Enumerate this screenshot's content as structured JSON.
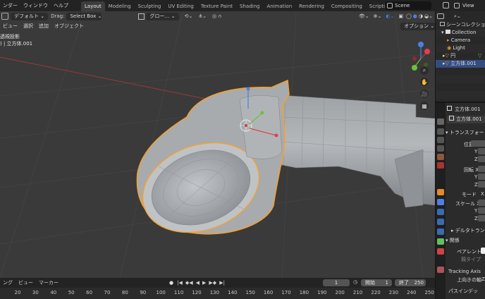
{
  "topbar": {
    "menus": [
      "ンダー",
      "ウィンドウ",
      "ヘルプ"
    ],
    "workspaces": [
      "Layout",
      "Modeling",
      "Sculpting",
      "UV Editing",
      "Texture Paint",
      "Shading",
      "Animation",
      "Rendering",
      "Compositing",
      "Scripting"
    ],
    "active_workspace": "Layout",
    "add_tab": "+",
    "scene_name": "Scene",
    "view_layer": "View"
  },
  "viewport_header": {
    "orientation": "デフォルト",
    "drag_label": "Drag:",
    "drag_value": "Select Box",
    "transform_orientation": "グロー…",
    "options_label": "オプション"
  },
  "viewport_menus": [
    "ビュー",
    "選択",
    "追加",
    "オブジェクト"
  ],
  "viewport_overlay": {
    "projection": "透視投影",
    "object_info": ") | 立方体.001"
  },
  "outliner": {
    "title": "シーンコレクション",
    "items": [
      "Collection",
      "Camera",
      "Light",
      "円",
      "立方体.001"
    ]
  },
  "properties": {
    "object_name": "立方体.001",
    "object_name_2": "立方体.001",
    "transform_header": "トランスフォー",
    "location_label": "位置 X",
    "rotation_label": "回転 X",
    "mode_label": "モード",
    "mode_value": "X",
    "scale_label": "スケール X",
    "y_label": "Y",
    "z_label": "Z",
    "delta_header": "デルタトラン",
    "relations_header": "関係",
    "parent_label": "ペアレント",
    "parent_type_label": "親タイプ",
    "tracking_axis_label": "Tracking Axis",
    "up_axis_label": "上向きの軸",
    "up_axis_value": "Z",
    "pass_index_label": "パスインデッ"
  },
  "timeline": {
    "menus": [
      "ング",
      "ビュー",
      "マーカー"
    ],
    "current_frame": "1",
    "start_label": "開始",
    "start_value": "1",
    "end_label": "終了",
    "end_value": "250",
    "ticks": [
      "20",
      "30",
      "40",
      "50",
      "60",
      "70",
      "80",
      "90",
      "100",
      "110",
      "120",
      "130",
      "140",
      "150",
      "160",
      "170",
      "180",
      "190",
      "200",
      "210",
      "220",
      "230",
      "240",
      "250"
    ]
  },
  "colors": {
    "accent": "#4772b3",
    "selection_outline": "#f5a030",
    "viewport_bg": "#3a3a3a",
    "panel_bg": "#2b2b2b"
  }
}
